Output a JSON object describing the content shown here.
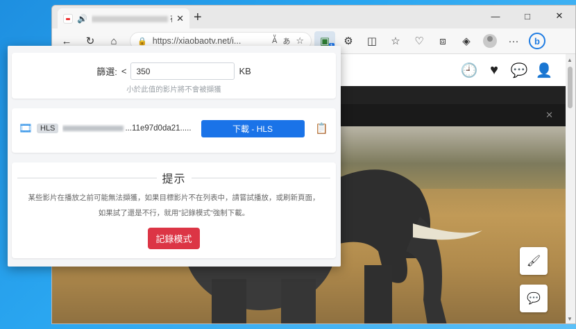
{
  "browser": {
    "tab_title_suffix": "在线",
    "tab_close": "✕",
    "new_tab": "+",
    "window": {
      "minimize": "—",
      "maximize": "□",
      "close": "✕"
    },
    "address": "https://xiaobaotv.net/i...",
    "extension_badge": "1"
  },
  "popup": {
    "filter": {
      "label": "篩選:",
      "operator": "<",
      "value": "350",
      "unit": "KB",
      "hint": "小於此值的影片將不會被擷獲"
    },
    "items": [
      {
        "type_tag": "HLS",
        "name_visible": "...11e97d0da21.....",
        "download_label": "下載 - HLS"
      }
    ],
    "tips": {
      "title": "提示",
      "line1": "某些影片在播放之前可能無法擷獲，如果目標影片不在列表中，請嘗試播放，或刷新頁面，",
      "line2": "如果試了還是不行，就用\"記錄模式\"強制下載。",
      "record_button": "記錄模式"
    }
  },
  "colors": {
    "primary": "#1a73e8",
    "danger": "#dc3545",
    "desktop": "#2aa6f0"
  }
}
